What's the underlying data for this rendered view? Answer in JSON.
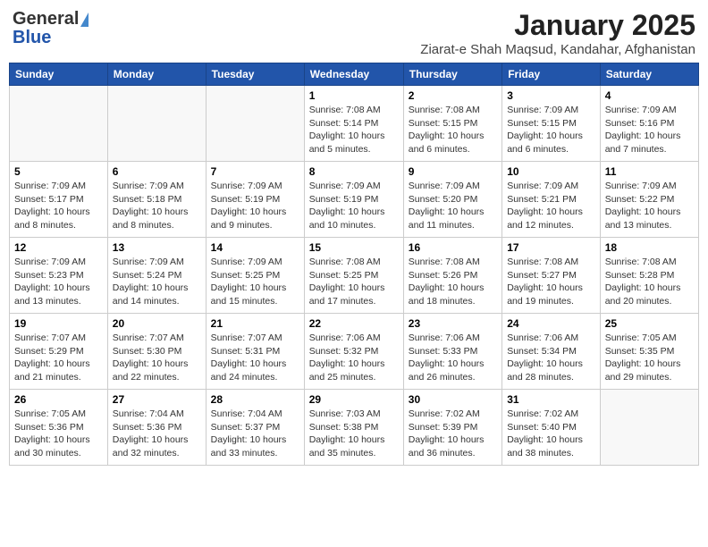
{
  "header": {
    "logo_general": "General",
    "logo_blue": "Blue",
    "month_title": "January 2025",
    "location": "Ziarat-e Shah Maqsud, Kandahar, Afghanistan"
  },
  "days_of_week": [
    "Sunday",
    "Monday",
    "Tuesday",
    "Wednesday",
    "Thursday",
    "Friday",
    "Saturday"
  ],
  "weeks": [
    [
      {
        "day": "",
        "info": ""
      },
      {
        "day": "",
        "info": ""
      },
      {
        "day": "",
        "info": ""
      },
      {
        "day": "1",
        "info": "Sunrise: 7:08 AM\nSunset: 5:14 PM\nDaylight: 10 hours and 5 minutes."
      },
      {
        "day": "2",
        "info": "Sunrise: 7:08 AM\nSunset: 5:15 PM\nDaylight: 10 hours and 6 minutes."
      },
      {
        "day": "3",
        "info": "Sunrise: 7:09 AM\nSunset: 5:15 PM\nDaylight: 10 hours and 6 minutes."
      },
      {
        "day": "4",
        "info": "Sunrise: 7:09 AM\nSunset: 5:16 PM\nDaylight: 10 hours and 7 minutes."
      }
    ],
    [
      {
        "day": "5",
        "info": "Sunrise: 7:09 AM\nSunset: 5:17 PM\nDaylight: 10 hours and 8 minutes."
      },
      {
        "day": "6",
        "info": "Sunrise: 7:09 AM\nSunset: 5:18 PM\nDaylight: 10 hours and 8 minutes."
      },
      {
        "day": "7",
        "info": "Sunrise: 7:09 AM\nSunset: 5:19 PM\nDaylight: 10 hours and 9 minutes."
      },
      {
        "day": "8",
        "info": "Sunrise: 7:09 AM\nSunset: 5:19 PM\nDaylight: 10 hours and 10 minutes."
      },
      {
        "day": "9",
        "info": "Sunrise: 7:09 AM\nSunset: 5:20 PM\nDaylight: 10 hours and 11 minutes."
      },
      {
        "day": "10",
        "info": "Sunrise: 7:09 AM\nSunset: 5:21 PM\nDaylight: 10 hours and 12 minutes."
      },
      {
        "day": "11",
        "info": "Sunrise: 7:09 AM\nSunset: 5:22 PM\nDaylight: 10 hours and 13 minutes."
      }
    ],
    [
      {
        "day": "12",
        "info": "Sunrise: 7:09 AM\nSunset: 5:23 PM\nDaylight: 10 hours and 13 minutes."
      },
      {
        "day": "13",
        "info": "Sunrise: 7:09 AM\nSunset: 5:24 PM\nDaylight: 10 hours and 14 minutes."
      },
      {
        "day": "14",
        "info": "Sunrise: 7:09 AM\nSunset: 5:25 PM\nDaylight: 10 hours and 15 minutes."
      },
      {
        "day": "15",
        "info": "Sunrise: 7:08 AM\nSunset: 5:25 PM\nDaylight: 10 hours and 17 minutes."
      },
      {
        "day": "16",
        "info": "Sunrise: 7:08 AM\nSunset: 5:26 PM\nDaylight: 10 hours and 18 minutes."
      },
      {
        "day": "17",
        "info": "Sunrise: 7:08 AM\nSunset: 5:27 PM\nDaylight: 10 hours and 19 minutes."
      },
      {
        "day": "18",
        "info": "Sunrise: 7:08 AM\nSunset: 5:28 PM\nDaylight: 10 hours and 20 minutes."
      }
    ],
    [
      {
        "day": "19",
        "info": "Sunrise: 7:07 AM\nSunset: 5:29 PM\nDaylight: 10 hours and 21 minutes."
      },
      {
        "day": "20",
        "info": "Sunrise: 7:07 AM\nSunset: 5:30 PM\nDaylight: 10 hours and 22 minutes."
      },
      {
        "day": "21",
        "info": "Sunrise: 7:07 AM\nSunset: 5:31 PM\nDaylight: 10 hours and 24 minutes."
      },
      {
        "day": "22",
        "info": "Sunrise: 7:06 AM\nSunset: 5:32 PM\nDaylight: 10 hours and 25 minutes."
      },
      {
        "day": "23",
        "info": "Sunrise: 7:06 AM\nSunset: 5:33 PM\nDaylight: 10 hours and 26 minutes."
      },
      {
        "day": "24",
        "info": "Sunrise: 7:06 AM\nSunset: 5:34 PM\nDaylight: 10 hours and 28 minutes."
      },
      {
        "day": "25",
        "info": "Sunrise: 7:05 AM\nSunset: 5:35 PM\nDaylight: 10 hours and 29 minutes."
      }
    ],
    [
      {
        "day": "26",
        "info": "Sunrise: 7:05 AM\nSunset: 5:36 PM\nDaylight: 10 hours and 30 minutes."
      },
      {
        "day": "27",
        "info": "Sunrise: 7:04 AM\nSunset: 5:36 PM\nDaylight: 10 hours and 32 minutes."
      },
      {
        "day": "28",
        "info": "Sunrise: 7:04 AM\nSunset: 5:37 PM\nDaylight: 10 hours and 33 minutes."
      },
      {
        "day": "29",
        "info": "Sunrise: 7:03 AM\nSunset: 5:38 PM\nDaylight: 10 hours and 35 minutes."
      },
      {
        "day": "30",
        "info": "Sunrise: 7:02 AM\nSunset: 5:39 PM\nDaylight: 10 hours and 36 minutes."
      },
      {
        "day": "31",
        "info": "Sunrise: 7:02 AM\nSunset: 5:40 PM\nDaylight: 10 hours and 38 minutes."
      },
      {
        "day": "",
        "info": ""
      }
    ]
  ]
}
